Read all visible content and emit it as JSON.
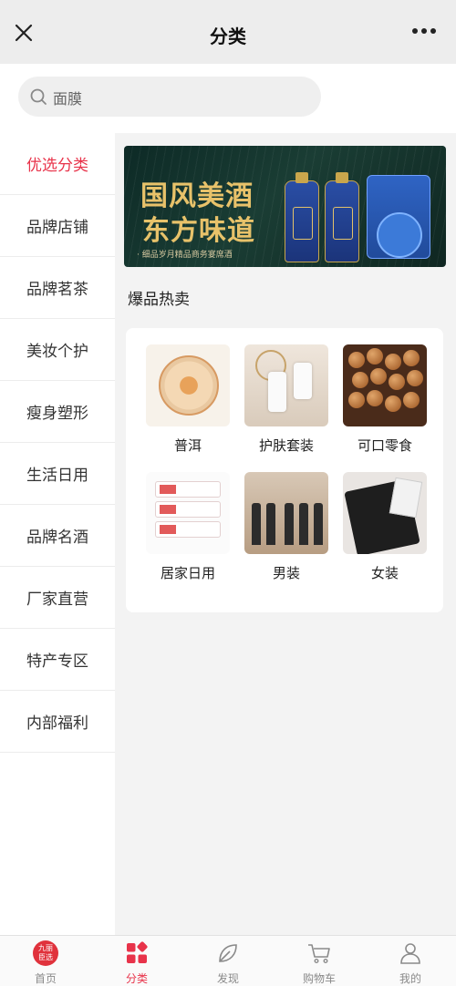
{
  "header": {
    "title": "分类"
  },
  "search": {
    "placeholder": "面膜"
  },
  "categories": [
    "优选分类",
    "品牌店铺",
    "品牌茗茶",
    "美妆个护",
    "瘦身塑形",
    "生活日用",
    "品牌名酒",
    "厂家直营",
    "特产专区",
    "内部福利"
  ],
  "banner": {
    "line1": "国风美酒",
    "line2": "东方味道",
    "tagline": "· 细品岁月精品商务宴席酒"
  },
  "section": {
    "title": "爆品热卖"
  },
  "products": [
    {
      "label": "普洱",
      "icon": "puer-tea-image"
    },
    {
      "label": "护肤套装",
      "icon": "skincare-set-image"
    },
    {
      "label": "可口零食",
      "icon": "snacks-image"
    },
    {
      "label": "居家日用",
      "icon": "household-image"
    },
    {
      "label": "男装",
      "icon": "menswear-image"
    },
    {
      "label": "女装",
      "icon": "womenswear-image"
    }
  ],
  "tabbar": {
    "home": "首页",
    "category": "分类",
    "discover": "发现",
    "cart": "购物车",
    "mine": "我的",
    "home_logo_line1": "九丽",
    "home_logo_line2": "臣选"
  },
  "colors": {
    "accent": "#e8334a",
    "banner_gold": "#e8c26a"
  }
}
